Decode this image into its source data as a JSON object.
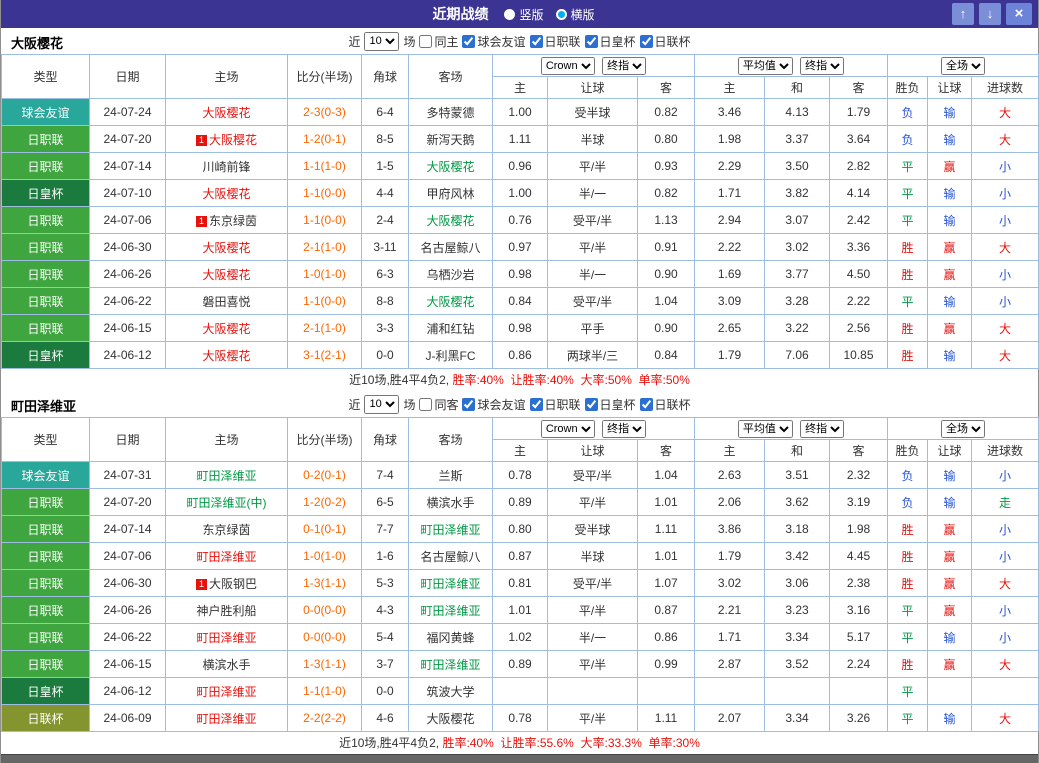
{
  "titlebar": {
    "title": "近期战绩",
    "radios": [
      {
        "label": "竖版",
        "selected": false
      },
      {
        "label": "横版",
        "selected": true
      }
    ],
    "buttons": {
      "up": "↑",
      "down": "↓",
      "close": "×"
    }
  },
  "labels": {
    "near": "近",
    "games": "场"
  },
  "controls": {
    "odds_source": "Crown",
    "odds_final": "终指",
    "avg_source": "平均值",
    "avg_final": "终指",
    "scope": "全场"
  },
  "table_header": {
    "cols": [
      "类型",
      "日期",
      "主场",
      "比分(半场)",
      "角球",
      "客场"
    ],
    "sub": [
      "主",
      "让球",
      "客",
      "主",
      "和",
      "客",
      "胜负",
      "让球",
      "进球数"
    ]
  },
  "palette": {
    "red": "#e8120d",
    "green": "#009944",
    "blue": "#2653d4",
    "black": "#333333",
    "orange": "#ff6600"
  },
  "league_colors": {
    "球会友谊": "#2aa79b",
    "日职联": "#3fa53f",
    "日皇杯": "#1b7a3d",
    "日联杯": "#84942f"
  },
  "sections": [
    {
      "team": "大阪樱花",
      "filter": {
        "count": "10",
        "same": {
          "label": "同主",
          "checked": false
        },
        "leagues": [
          {
            "label": "球会友谊",
            "checked": true
          },
          {
            "label": "日职联",
            "checked": true
          },
          {
            "label": "日皇杯",
            "checked": true
          },
          {
            "label": "日联杯",
            "checked": true
          }
        ]
      },
      "rows": [
        {
          "type": "球会友谊",
          "date": "24-07-24",
          "home": {
            "text": "大阪樱花",
            "color": "red",
            "badge": ""
          },
          "score": "2-3(0-3)",
          "corner": "6-4",
          "away": {
            "text": "多特蒙德",
            "color": "black"
          },
          "odds": [
            "1.00",
            "受半球",
            "0.82"
          ],
          "avg": [
            "3.46",
            "4.13",
            "1.79"
          ],
          "results": [
            {
              "text": "负",
              "color": "blue"
            },
            {
              "text": "输",
              "color": "blue"
            },
            {
              "text": "大",
              "color": "red"
            }
          ]
        },
        {
          "type": "日职联",
          "date": "24-07-20",
          "home": {
            "text": "大阪樱花",
            "color": "red",
            "badge": "1"
          },
          "score": "1-2(0-1)",
          "corner": "8-5",
          "away": {
            "text": "新泻天鹅",
            "color": "black"
          },
          "odds": [
            "1.11",
            "半球",
            "0.80"
          ],
          "avg": [
            "1.98",
            "3.37",
            "3.64"
          ],
          "results": [
            {
              "text": "负",
              "color": "blue"
            },
            {
              "text": "输",
              "color": "blue"
            },
            {
              "text": "大",
              "color": "red"
            }
          ]
        },
        {
          "type": "日职联",
          "date": "24-07-14",
          "home": {
            "text": "川崎前锋",
            "color": "black",
            "badge": ""
          },
          "score": "1-1(1-0)",
          "corner": "1-5",
          "away": {
            "text": "大阪樱花",
            "color": "green"
          },
          "odds": [
            "0.96",
            "平/半",
            "0.93"
          ],
          "avg": [
            "2.29",
            "3.50",
            "2.82"
          ],
          "results": [
            {
              "text": "平",
              "color": "green"
            },
            {
              "text": "赢",
              "color": "red"
            },
            {
              "text": "小",
              "color": "blue"
            }
          ]
        },
        {
          "type": "日皇杯",
          "date": "24-07-10",
          "home": {
            "text": "大阪樱花",
            "color": "red",
            "badge": ""
          },
          "score": "1-1(0-0)",
          "corner": "4-4",
          "away": {
            "text": "甲府风林",
            "color": "black"
          },
          "odds": [
            "1.00",
            "半/一",
            "0.82"
          ],
          "avg": [
            "1.71",
            "3.82",
            "4.14"
          ],
          "results": [
            {
              "text": "平",
              "color": "green"
            },
            {
              "text": "输",
              "color": "blue"
            },
            {
              "text": "小",
              "color": "blue"
            }
          ]
        },
        {
          "type": "日职联",
          "date": "24-07-06",
          "home": {
            "text": "东京绿茵",
            "color": "black",
            "badge": "1"
          },
          "score": "1-1(0-0)",
          "corner": "2-4",
          "away": {
            "text": "大阪樱花",
            "color": "green"
          },
          "odds": [
            "0.76",
            "受平/半",
            "1.13"
          ],
          "avg": [
            "2.94",
            "3.07",
            "2.42"
          ],
          "results": [
            {
              "text": "平",
              "color": "green"
            },
            {
              "text": "输",
              "color": "blue"
            },
            {
              "text": "小",
              "color": "blue"
            }
          ]
        },
        {
          "type": "日职联",
          "date": "24-06-30",
          "home": {
            "text": "大阪樱花",
            "color": "red",
            "badge": ""
          },
          "score": "2-1(1-0)",
          "corner": "3-11",
          "away": {
            "text": "名古屋鲸八",
            "color": "black"
          },
          "odds": [
            "0.97",
            "平/半",
            "0.91"
          ],
          "avg": [
            "2.22",
            "3.02",
            "3.36"
          ],
          "results": [
            {
              "text": "胜",
              "color": "red"
            },
            {
              "text": "赢",
              "color": "red"
            },
            {
              "text": "大",
              "color": "red"
            }
          ]
        },
        {
          "type": "日职联",
          "date": "24-06-26",
          "home": {
            "text": "大阪樱花",
            "color": "red",
            "badge": ""
          },
          "score": "1-0(1-0)",
          "corner": "6-3",
          "away": {
            "text": "乌栖沙岩",
            "color": "black"
          },
          "odds": [
            "0.98",
            "半/一",
            "0.90"
          ],
          "avg": [
            "1.69",
            "3.77",
            "4.50"
          ],
          "results": [
            {
              "text": "胜",
              "color": "red"
            },
            {
              "text": "赢",
              "color": "red"
            },
            {
              "text": "小",
              "color": "blue"
            }
          ]
        },
        {
          "type": "日职联",
          "date": "24-06-22",
          "home": {
            "text": "磐田喜悦",
            "color": "black",
            "badge": ""
          },
          "score": "1-1(0-0)",
          "corner": "8-8",
          "away": {
            "text": "大阪樱花",
            "color": "green"
          },
          "odds": [
            "0.84",
            "受平/半",
            "1.04"
          ],
          "avg": [
            "3.09",
            "3.28",
            "2.22"
          ],
          "results": [
            {
              "text": "平",
              "color": "green"
            },
            {
              "text": "输",
              "color": "blue"
            },
            {
              "text": "小",
              "color": "blue"
            }
          ]
        },
        {
          "type": "日职联",
          "date": "24-06-15",
          "home": {
            "text": "大阪樱花",
            "color": "red",
            "badge": ""
          },
          "score": "2-1(1-0)",
          "corner": "3-3",
          "away": {
            "text": "浦和红钻",
            "color": "black"
          },
          "odds": [
            "0.98",
            "平手",
            "0.90"
          ],
          "avg": [
            "2.65",
            "3.22",
            "2.56"
          ],
          "results": [
            {
              "text": "胜",
              "color": "red"
            },
            {
              "text": "赢",
              "color": "red"
            },
            {
              "text": "大",
              "color": "red"
            }
          ]
        },
        {
          "type": "日皇杯",
          "date": "24-06-12",
          "home": {
            "text": "大阪樱花",
            "color": "red",
            "badge": ""
          },
          "score": "3-1(2-1)",
          "corner": "0-0",
          "away": {
            "text": "J-利黑FC",
            "color": "black"
          },
          "odds": [
            "0.86",
            "两球半/三",
            "0.84"
          ],
          "avg": [
            "1.79",
            "7.06",
            "10.85"
          ],
          "results": [
            {
              "text": "胜",
              "color": "red"
            },
            {
              "text": "输",
              "color": "blue"
            },
            {
              "text": "大",
              "color": "red"
            }
          ]
        }
      ],
      "footer": {
        "prefix": "近10场,胜4平4负2,",
        "stats": "胜率:40%  让胜率:40%  大率:50%  单率:50%"
      }
    },
    {
      "team": "町田泽维亚",
      "filter": {
        "count": "10",
        "same": {
          "label": "同客",
          "checked": false
        },
        "leagues": [
          {
            "label": "球会友谊",
            "checked": true
          },
          {
            "label": "日职联",
            "checked": true
          },
          {
            "label": "日皇杯",
            "checked": true
          },
          {
            "label": "日联杯",
            "checked": true
          }
        ]
      },
      "rows": [
        {
          "type": "球会友谊",
          "date": "24-07-31",
          "home": {
            "text": "町田泽维亚",
            "color": "green",
            "badge": ""
          },
          "score": "0-2(0-1)",
          "corner": "7-4",
          "away": {
            "text": "兰斯",
            "color": "black"
          },
          "odds": [
            "0.78",
            "受平/半",
            "1.04"
          ],
          "avg": [
            "2.63",
            "3.51",
            "2.32"
          ],
          "results": [
            {
              "text": "负",
              "color": "blue"
            },
            {
              "text": "输",
              "color": "blue"
            },
            {
              "text": "小",
              "color": "blue"
            }
          ]
        },
        {
          "type": "日职联",
          "date": "24-07-20",
          "home": {
            "text": "町田泽维亚(中)",
            "color": "green",
            "badge": ""
          },
          "score": "1-2(0-2)",
          "corner": "6-5",
          "away": {
            "text": "横滨水手",
            "color": "black"
          },
          "odds": [
            "0.89",
            "平/半",
            "1.01"
          ],
          "avg": [
            "2.06",
            "3.62",
            "3.19"
          ],
          "results": [
            {
              "text": "负",
              "color": "blue"
            },
            {
              "text": "输",
              "color": "blue"
            },
            {
              "text": "走",
              "color": "green"
            }
          ]
        },
        {
          "type": "日职联",
          "date": "24-07-14",
          "home": {
            "text": "东京绿茵",
            "color": "black",
            "badge": ""
          },
          "score": "0-1(0-1)",
          "corner": "7-7",
          "away": {
            "text": "町田泽维亚",
            "color": "green"
          },
          "odds": [
            "0.80",
            "受半球",
            "1.11"
          ],
          "avg": [
            "3.86",
            "3.18",
            "1.98"
          ],
          "results": [
            {
              "text": "胜",
              "color": "red"
            },
            {
              "text": "赢",
              "color": "red"
            },
            {
              "text": "小",
              "color": "blue"
            }
          ]
        },
        {
          "type": "日职联",
          "date": "24-07-06",
          "home": {
            "text": "町田泽维亚",
            "color": "red",
            "badge": ""
          },
          "score": "1-0(1-0)",
          "corner": "1-6",
          "away": {
            "text": "名古屋鲸八",
            "color": "black"
          },
          "odds": [
            "0.87",
            "半球",
            "1.01"
          ],
          "avg": [
            "1.79",
            "3.42",
            "4.45"
          ],
          "results": [
            {
              "text": "胜",
              "color": "red"
            },
            {
              "text": "赢",
              "color": "red"
            },
            {
              "text": "小",
              "color": "blue"
            }
          ]
        },
        {
          "type": "日职联",
          "date": "24-06-30",
          "home": {
            "text": "大阪钢巴",
            "color": "black",
            "badge": "1"
          },
          "score": "1-3(1-1)",
          "corner": "5-3",
          "away": {
            "text": "町田泽维亚",
            "color": "green"
          },
          "odds": [
            "0.81",
            "受平/半",
            "1.07"
          ],
          "avg": [
            "3.02",
            "3.06",
            "2.38"
          ],
          "results": [
            {
              "text": "胜",
              "color": "red"
            },
            {
              "text": "赢",
              "color": "red"
            },
            {
              "text": "大",
              "color": "red"
            }
          ]
        },
        {
          "type": "日职联",
          "date": "24-06-26",
          "home": {
            "text": "神户胜利船",
            "color": "black",
            "badge": ""
          },
          "score": "0-0(0-0)",
          "corner": "4-3",
          "away": {
            "text": "町田泽维亚",
            "color": "green"
          },
          "odds": [
            "1.01",
            "平/半",
            "0.87"
          ],
          "avg": [
            "2.21",
            "3.23",
            "3.16"
          ],
          "results": [
            {
              "text": "平",
              "color": "green"
            },
            {
              "text": "赢",
              "color": "red"
            },
            {
              "text": "小",
              "color": "blue"
            }
          ]
        },
        {
          "type": "日职联",
          "date": "24-06-22",
          "home": {
            "text": "町田泽维亚",
            "color": "red",
            "badge": ""
          },
          "score": "0-0(0-0)",
          "corner": "5-4",
          "away": {
            "text": "福冈黄蜂",
            "color": "black"
          },
          "odds": [
            "1.02",
            "半/一",
            "0.86"
          ],
          "avg": [
            "1.71",
            "3.34",
            "5.17"
          ],
          "results": [
            {
              "text": "平",
              "color": "green"
            },
            {
              "text": "输",
              "color": "blue"
            },
            {
              "text": "小",
              "color": "blue"
            }
          ]
        },
        {
          "type": "日职联",
          "date": "24-06-15",
          "home": {
            "text": "横滨水手",
            "color": "black",
            "badge": ""
          },
          "score": "1-3(1-1)",
          "corner": "3-7",
          "away": {
            "text": "町田泽维亚",
            "color": "green"
          },
          "odds": [
            "0.89",
            "平/半",
            "0.99"
          ],
          "avg": [
            "2.87",
            "3.52",
            "2.24"
          ],
          "results": [
            {
              "text": "胜",
              "color": "red"
            },
            {
              "text": "赢",
              "color": "red"
            },
            {
              "text": "大",
              "color": "red"
            }
          ]
        },
        {
          "type": "日皇杯",
          "date": "24-06-12",
          "home": {
            "text": "町田泽维亚",
            "color": "red",
            "badge": ""
          },
          "score": "1-1(1-0)",
          "corner": "0-0",
          "away": {
            "text": "筑波大学",
            "color": "black"
          },
          "odds": [
            "",
            "",
            ""
          ],
          "avg": [
            "",
            "",
            ""
          ],
          "results": [
            {
              "text": "平",
              "color": "green"
            },
            {
              "text": "",
              "color": "black"
            },
            {
              "text": "",
              "color": "black"
            }
          ]
        },
        {
          "type": "日联杯",
          "date": "24-06-09",
          "home": {
            "text": "町田泽维亚",
            "color": "red",
            "badge": ""
          },
          "score": "2-2(2-2)",
          "corner": "4-6",
          "away": {
            "text": "大阪樱花",
            "color": "black"
          },
          "odds": [
            "0.78",
            "平/半",
            "1.11"
          ],
          "avg": [
            "2.07",
            "3.34",
            "3.26"
          ],
          "results": [
            {
              "text": "平",
              "color": "green"
            },
            {
              "text": "输",
              "color": "blue"
            },
            {
              "text": "大",
              "color": "red"
            }
          ]
        }
      ],
      "footer": {
        "prefix": "近10场,胜4平4负2,",
        "stats": "胜率:40%  让胜率:55.6%  大率:33.3%  单率:30%"
      }
    }
  ]
}
